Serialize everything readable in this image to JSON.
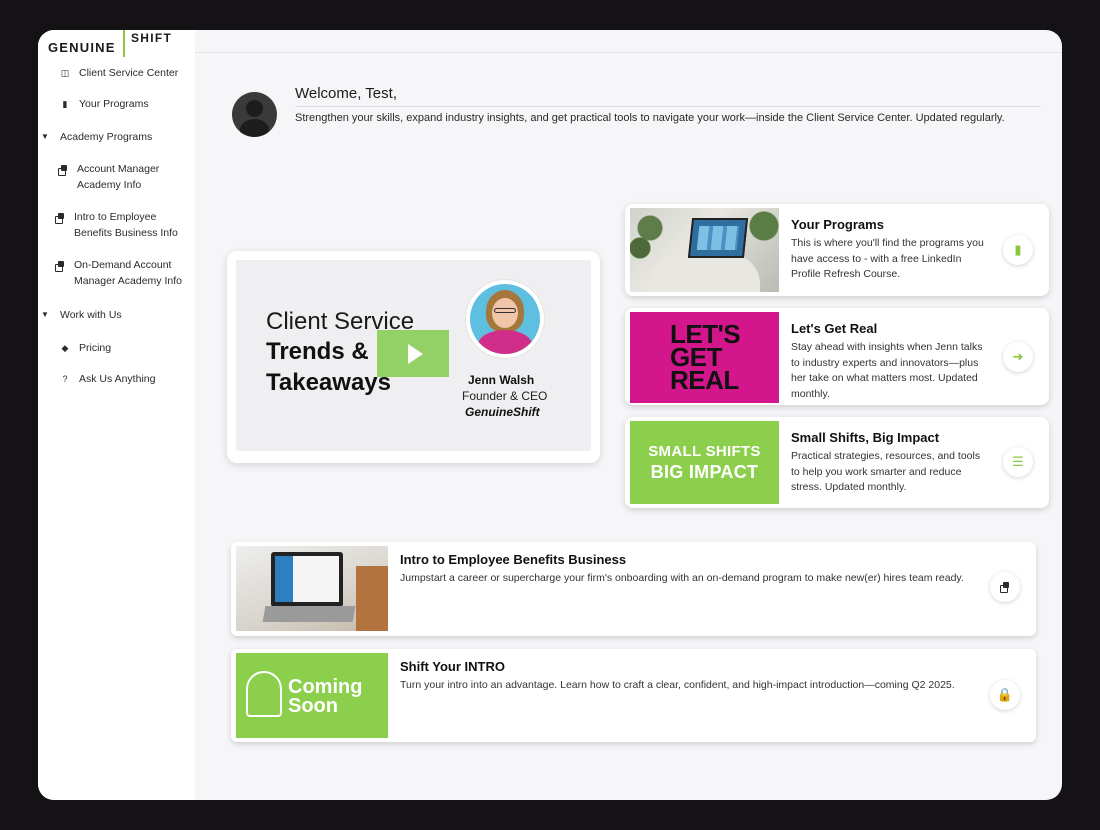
{
  "logo": {
    "word1": "GENUINE",
    "word2": "SHIFT"
  },
  "sidebar": {
    "items": [
      {
        "label": "Client Service Center",
        "icon": "table-icon"
      },
      {
        "label": "Your Programs",
        "icon": "book-icon"
      },
      {
        "label": "Academy Programs",
        "icon": "caret-down-icon"
      },
      {
        "label": "Account Manager Academy Info",
        "icon": "stack-icon"
      },
      {
        "label": "Intro to Employee Benefits Business Info",
        "icon": "stack-icon"
      },
      {
        "label": "On-Demand Account Manager Academy Info",
        "icon": "stack-icon"
      },
      {
        "label": "Work with Us",
        "icon": "caret-down-icon"
      },
      {
        "label": "Pricing",
        "icon": "tag-icon"
      },
      {
        "label": "Ask Us Anything",
        "icon": "question-icon"
      }
    ]
  },
  "welcome": {
    "title": "Welcome, Test,",
    "text": "Strengthen your skills, expand industry insights, and get practical tools to navigate your work—inside the Client Service Center. Updated regularly."
  },
  "video": {
    "line1": "Client Service",
    "line2": "Trends &",
    "line3": "Takeaways",
    "speaker_name": "Jenn Walsh",
    "speaker_title": "Founder & CEO",
    "speaker_company": "GenuineShift"
  },
  "cards": [
    {
      "title": "Your Programs",
      "desc": "This is where you'll find the programs you have access to - with a free LinkedIn Profile Refresh Course.",
      "action_icon": "book-icon"
    },
    {
      "title": "Let's Get Real",
      "desc": "Stay ahead with insights when Jenn talks to industry experts and innovators—plus her take on what matters most. Updated monthly.",
      "image_text": [
        "LET'S",
        "GET",
        "REAL"
      ],
      "action_icon": "sign-in-icon"
    },
    {
      "title": "Small Shifts, Big Impact",
      "desc": "Practical strategies, resources, and tools to help you work smarter and reduce stress. Updated monthly.",
      "image_text": [
        "SMALL SHIFTS",
        "BIG IMPACT"
      ],
      "action_icon": "checklist-icon"
    }
  ],
  "wide_cards": [
    {
      "title": "Intro to Employee Benefits Business",
      "desc": "Jumpstart a career or supercharge your firm's onboarding with an on-demand program to make new(er) hires team ready.",
      "action_icon": "stack-icon"
    },
    {
      "title": "Shift Your INTRO",
      "desc": "Turn your intro into an advantage. Learn how to craft a clear, confident, and high-impact introduction—coming Q2 2025.",
      "image_text": [
        "Coming",
        "Soon"
      ],
      "action_icon": "lock-icon"
    }
  ],
  "colors": {
    "accent": "#8cc63f",
    "magenta": "#d4168c"
  }
}
